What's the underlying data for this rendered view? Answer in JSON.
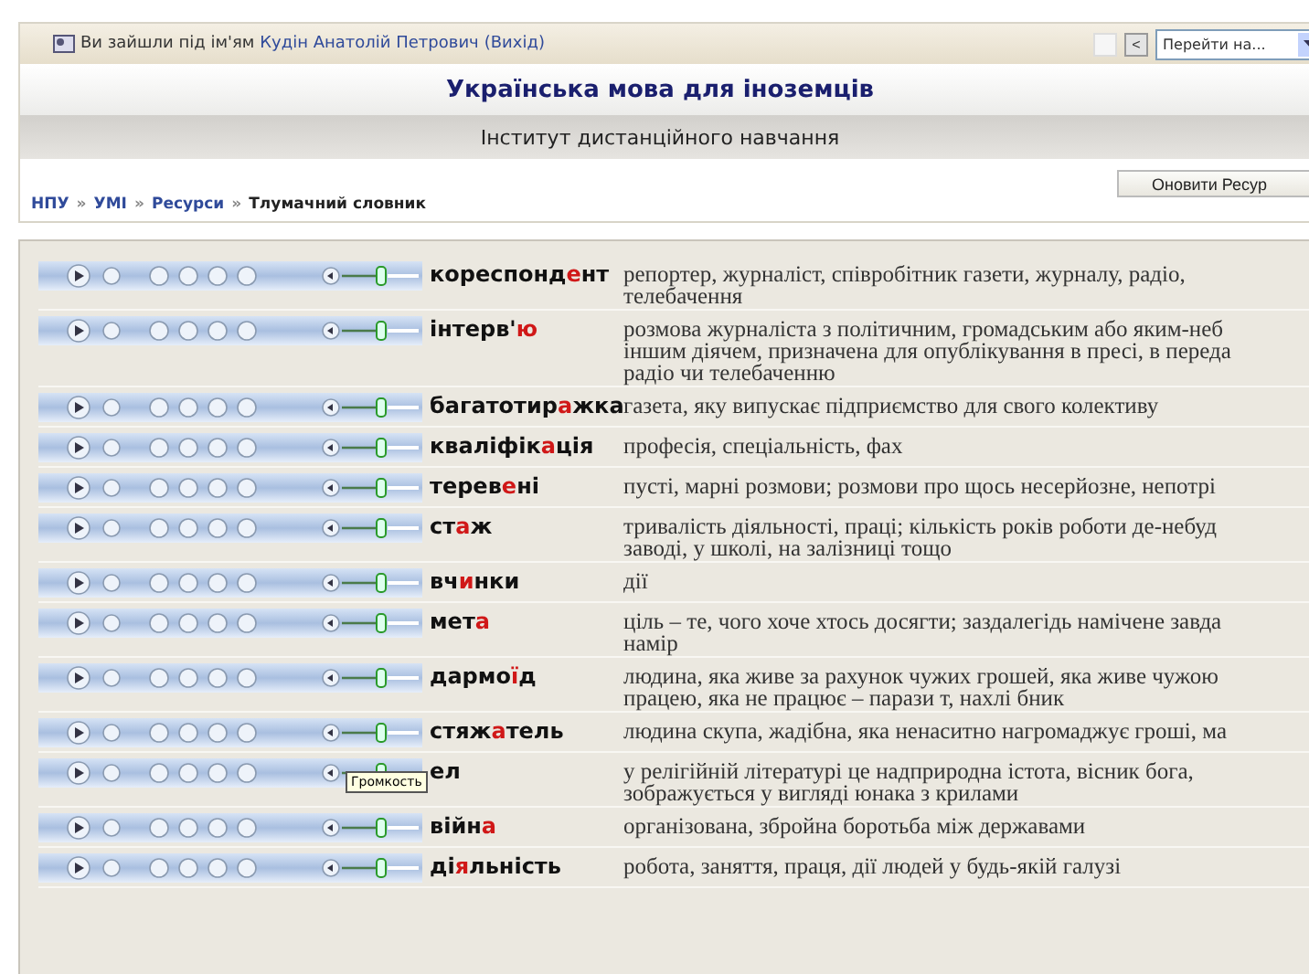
{
  "top_bar": {
    "login_text": "Ви зайшли під ім'ям",
    "user_link": "Кудін Анатолій Петрович",
    "logout_link": "(Вихід)",
    "nav_buttons": [
      {
        "disabled": true
      },
      {
        "label": "<",
        "disabled": false
      }
    ],
    "jump_select": {
      "value": "Перейти на..."
    }
  },
  "header": {
    "title": "Українська мова для іноземців",
    "subtitle": "Інститут дистанційного навчання"
  },
  "breadcrumb": [
    {
      "label": "НПУ",
      "current": false
    },
    {
      "label": "УМІ",
      "current": false
    },
    {
      "label": "Ресурси",
      "current": false
    },
    {
      "label": "Тлумачний словник",
      "current": true
    }
  ],
  "separator": "»",
  "update_button": "Оновити Ресур",
  "entries": [
    {
      "word": {
        "pre": "кореспонд",
        "stress": "е",
        "post": "нт"
      },
      "definition": [
        "репортер, журналіст, співробітник газети, журналу, радіо,",
        "телебачення"
      ]
    },
    {
      "word": {
        "pre": "інтерв'",
        "stress": "ю"
      },
      "definition": [
        "розмова журналіста з політичним, громадським або яким-неб",
        "іншим діячем, призначена для опублікування в пресі, в переда",
        "радіо чи телебаченню"
      ]
    },
    {
      "word": {
        "pre": "багатотир",
        "stress": "а",
        "post": "жка"
      },
      "definition": [
        "газета, яку випускає підприємство для свого колективу"
      ]
    },
    {
      "word": {
        "pre": "кваліфік",
        "stress": "а",
        "post": "ція"
      },
      "definition": [
        "професія, спеціальність, фах"
      ]
    },
    {
      "word": {
        "pre": "терев",
        "stress": "е",
        "post": "ні"
      },
      "definition": [
        "пусті, марні розмови; розмови про щось несерйозне, непотрі"
      ]
    },
    {
      "word": {
        "pre": "ст",
        "stress": "а",
        "post": "ж"
      },
      "definition": [
        "тривалість діяльності, праці; кількість років роботи де-небуд",
        "заводі, у школі, на залізниці тощо"
      ]
    },
    {
      "word": {
        "pre": "вч",
        "stress": "и",
        "post": "нки"
      },
      "definition": [
        "дії"
      ]
    },
    {
      "word": {
        "pre": "мет",
        "stress": "а"
      },
      "definition": [
        "ціль – те, чого хоче хтось досягти; заздалегідь намічене завда",
        "намір"
      ]
    },
    {
      "word": {
        "pre": "дармо",
        "stress": "ї",
        "post": "д"
      },
      "definition": [
        "людина, яка живе за рахунок чужих грошей, яка живе чужою",
        "працею, яка не працює – парази т, нахлі бник"
      ]
    },
    {
      "word": {
        "pre": "стяж",
        "stress": "а",
        "post": "тель"
      },
      "definition": [
        "людина скупа, жадібна, яка ненаситно нагромаджує гроші,  ма"
      ]
    },
    {
      "word": {
        "post": "ел"
      },
      "tooltip": "Громкость",
      "definition": [
        "у релігійній літературі це надприродна істота, вісник бога,",
        "зображується у вигляді юнака з крилами"
      ]
    },
    {
      "word": {
        "pre": "війн",
        "stress": "а"
      },
      "definition": [
        "організована, збройна боротьба між державами"
      ]
    },
    {
      "word": {
        "pre": "ді",
        "stress": "я",
        "post": "льність"
      },
      "definition": [
        "робота, заняття, праця, дії людей у будь-якій галузі"
      ]
    }
  ]
}
